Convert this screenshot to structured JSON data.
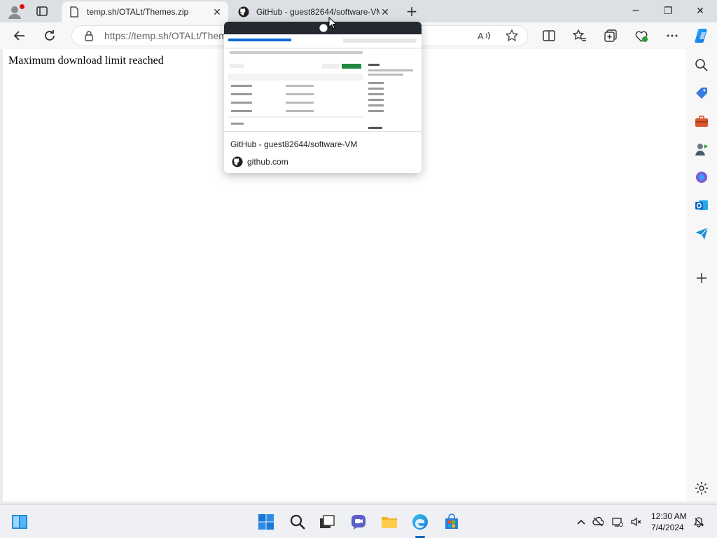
{
  "tabs": [
    {
      "title": "temp.sh/OTALt/Themes.zip",
      "active": true
    },
    {
      "title": "GitHub - guest82644/software-VM",
      "active": false
    }
  ],
  "toolbar": {
    "url": "https://temp.sh/OTALt/Themes.zip"
  },
  "content": {
    "message": "Maximum download limit reached"
  },
  "hover_card": {
    "title": "GitHub - guest82644/software-VM",
    "domain": "github.com"
  },
  "taskbar": {
    "time": "12:30 AM",
    "date": "7/4/2024"
  },
  "colors": {
    "edge_accent": "#0067c0",
    "notification_dot": "#dd1111"
  }
}
